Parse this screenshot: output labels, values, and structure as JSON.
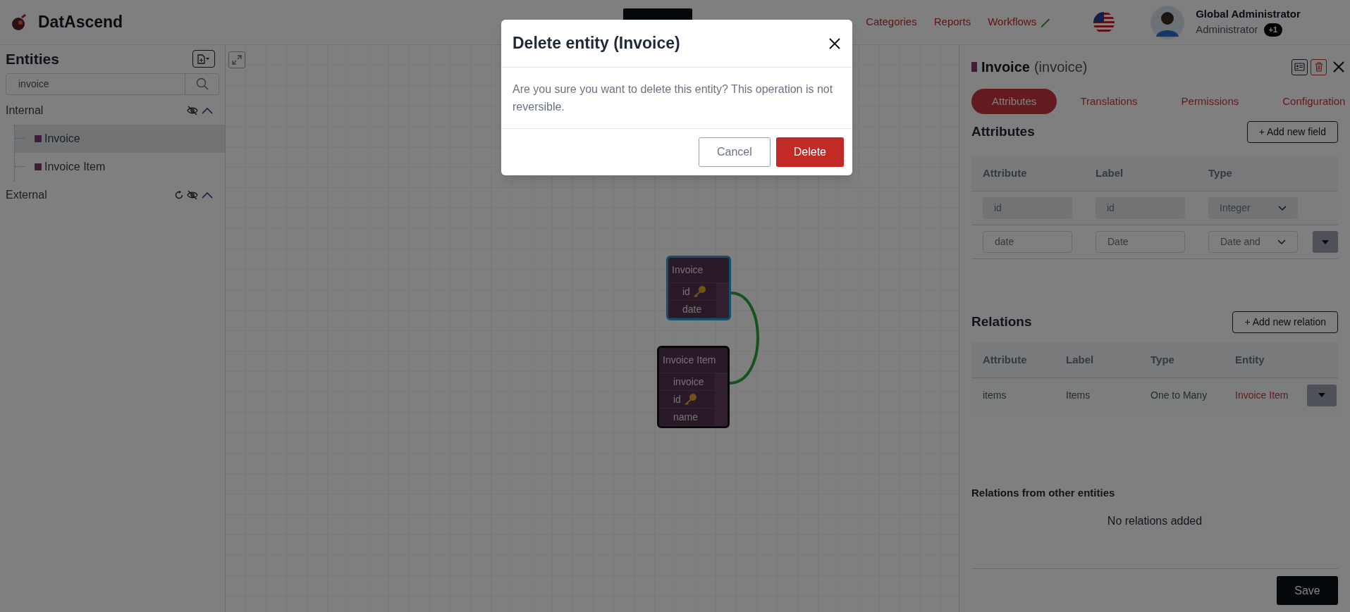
{
  "app": {
    "name": "DatAscend"
  },
  "nav_items": [
    {
      "label": "Categories"
    },
    {
      "label": "Reports"
    },
    {
      "label": "Workflows"
    }
  ],
  "user": {
    "name": "Global Administrator",
    "role": "Administrator",
    "badge": "+1"
  },
  "sidebar": {
    "title": "Entities",
    "search": {
      "value": "invoice"
    },
    "groups": [
      {
        "label": "Internal",
        "expanded": true,
        "refreshable": false,
        "children": [
          {
            "label": "Invoice",
            "selected": true
          },
          {
            "label": "Invoice Item",
            "selected": false
          }
        ]
      },
      {
        "label": "External",
        "expanded": true,
        "refreshable": true
      }
    ]
  },
  "canvas": {
    "nodes": [
      {
        "title": "Invoice",
        "selected": true,
        "fields": [
          {
            "name": "id",
            "key": true
          },
          {
            "name": "date",
            "key": false
          }
        ]
      },
      {
        "title": "Invoice Item",
        "selected": false,
        "fields": [
          {
            "name": "invoice",
            "key": false
          },
          {
            "name": "id",
            "key": true
          },
          {
            "name": "name",
            "key": false
          }
        ]
      }
    ]
  },
  "detail": {
    "title": "Invoice",
    "subtitle": "(invoice)",
    "tabs": [
      {
        "label": "Attributes",
        "selected": true
      },
      {
        "label": "Translations",
        "selected": false
      },
      {
        "label": "Permissions",
        "selected": false
      },
      {
        "label": "Configuration",
        "selected": false
      }
    ],
    "attributes": {
      "heading": "Attributes",
      "add_button": "+ Add new field",
      "columns": [
        "Attribute",
        "Label",
        "Type"
      ],
      "rows": [
        {
          "attribute": "id",
          "label": "id",
          "type": "Integer",
          "disabled": true
        },
        {
          "attribute": "date",
          "label": "Date",
          "type": "Date and",
          "disabled": false
        }
      ]
    },
    "relations": {
      "heading": "Relations",
      "add_button": "+ Add new relation",
      "columns": [
        "Attribute",
        "Label",
        "Type",
        "Entity"
      ],
      "rows": [
        {
          "attribute": "items",
          "label": "Items",
          "type": "One to Many",
          "entity": "Invoice Item"
        }
      ]
    },
    "incoming": {
      "heading": "Relations from other entities",
      "empty_text": "No relations added"
    },
    "save_button": "Save"
  },
  "modal": {
    "title": "Delete entity (Invoice)",
    "message": "Are you sure you want to delete this entity? This operation is not reversible.",
    "buttons": [
      {
        "label": "Cancel",
        "kind": "secondary"
      },
      {
        "label": "Delete",
        "kind": "danger"
      }
    ]
  }
}
